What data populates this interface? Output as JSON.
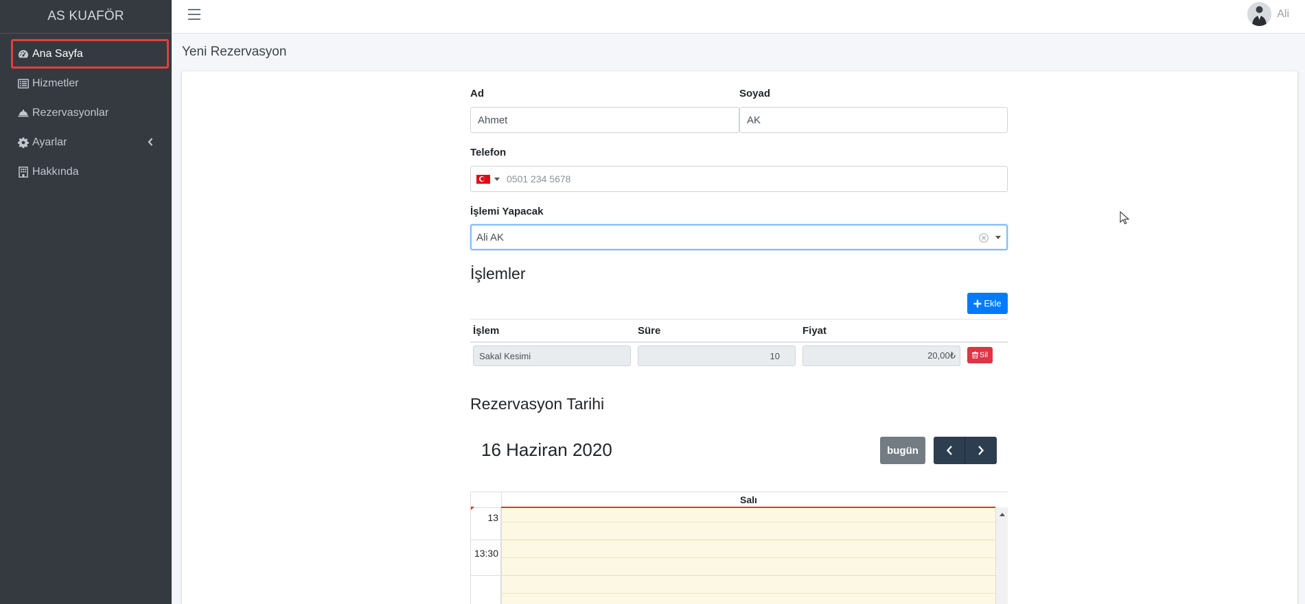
{
  "app": {
    "brand": "AS KUAFÖR"
  },
  "sidebar": {
    "items": [
      {
        "label": "Ana Sayfa",
        "icon": "dashboard-icon",
        "active": true
      },
      {
        "label": "Hizmetler",
        "icon": "list-icon"
      },
      {
        "label": "Rezervasyonlar",
        "icon": "cloche-icon"
      },
      {
        "label": "Ayarlar",
        "icon": "gear-icon",
        "has_submenu": true
      },
      {
        "label": "Hakkında",
        "icon": "building-icon"
      }
    ]
  },
  "topbar": {
    "user_name": "Ali"
  },
  "page": {
    "title": "Yeni Rezervasyon"
  },
  "form": {
    "ad_label": "Ad",
    "ad_value": "Ahmet",
    "soyad_label": "Soyad",
    "soyad_value": "AK",
    "telefon_label": "Telefon",
    "telefon_placeholder": "0501 234 5678",
    "islemi_yapacak_label": "İşlemi Yapacak",
    "islemi_yapacak_value": "Ali AK"
  },
  "islemler": {
    "title": "İşlemler",
    "add_button": "Ekle",
    "columns": [
      "İşlem",
      "Süre",
      "Fiyat"
    ],
    "rows": [
      {
        "islem": "Sakal Kesimi",
        "sure": "10",
        "fiyat": "20,00₺",
        "delete_label": "Sil"
      }
    ]
  },
  "rezervasyon": {
    "title": "Rezervasyon Tarihi",
    "date": "16 Haziran 2020",
    "today_button": "bugün",
    "day_header": "Salı",
    "times": [
      "13",
      "13:30"
    ]
  },
  "colors": {
    "sidebar_bg": "#343a40",
    "active_outline": "#e2403f",
    "primary": "#007bff",
    "danger": "#dc3545",
    "calendar_today_bg": "#fcf8e3"
  }
}
